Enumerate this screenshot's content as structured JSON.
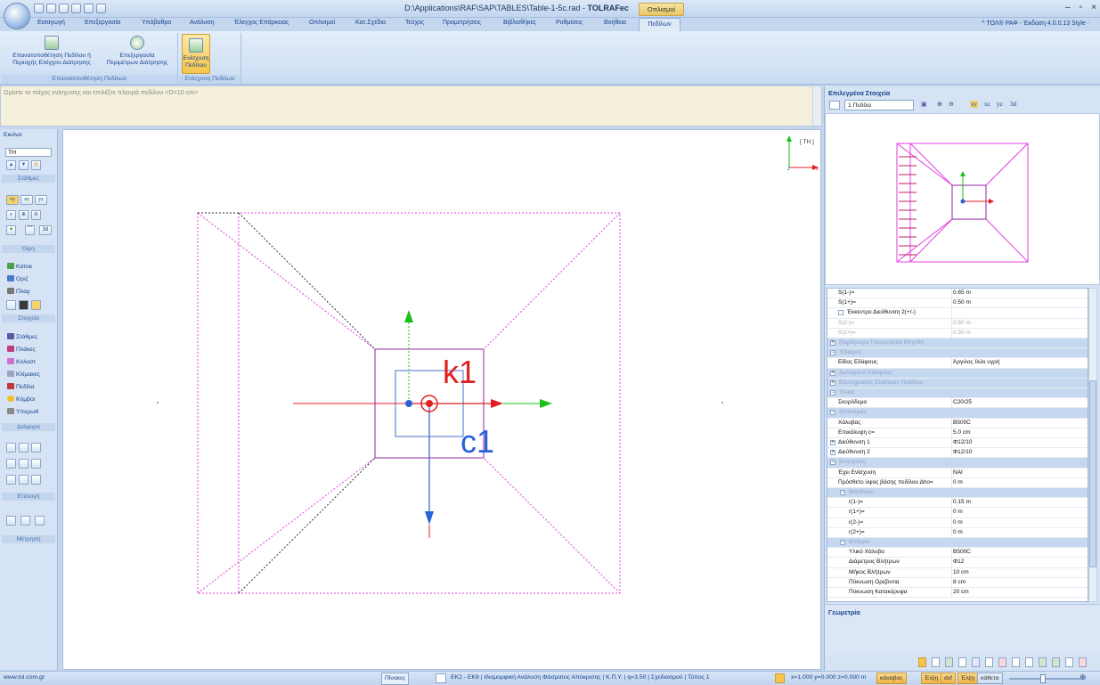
{
  "window": {
    "path": "D:\\Applications\\RAF\\SAP\\TABLES\\Table-1-5c.rad - ",
    "app": "TOLRAFec",
    "context_tab": "Οπλισμοί",
    "controls": [
      "–",
      "▫",
      "×"
    ]
  },
  "menu": {
    "tabs": [
      "Εισαγωγή",
      "Επεξεργασία",
      "Υπόβαθρο",
      "Ανάλυση",
      "Έλεγχος Επάρκειας",
      "Οπλισμοί",
      "Κατ.Σχέδια",
      "Τεύχος",
      "Προμετρήσεις",
      "Βιβλιοθήκες",
      "Ρυθμίσεις",
      "Βοήθεια"
    ],
    "active_tab": "Πεδίλων",
    "version": "^ ΤΟΛ® ΡΑΦ - Έκδοση 4.0.0.13   Style ·"
  },
  "ribbon": {
    "group1": {
      "btn1": [
        "Επανατοποθέτηση Πεδίλου ή",
        "Περιοχής Ελέγχου Διάτρησης"
      ],
      "btn2": [
        "Επεξεργασία",
        "Περιμέτρων Διάτρησης"
      ],
      "label": "Επανατοποθέτηση Πεδίλων"
    },
    "group2": {
      "btn1": [
        "Ενίσχυση",
        "Πεδίλου"
      ],
      "label": "Ενίσχυση Πεδίλων"
    }
  },
  "prompt": "Ορίστε το πάχος ενίσχυσης και επιλέξτε πλευρά πεδίλου  <D=10 cm>",
  "left_panel": {
    "title": "Εικόνα",
    "view_select": "TH",
    "sections": {
      "stathmes": "Στάθμες",
      "opsi": "Όψη",
      "stoixeia": "Στοιχεία",
      "diafora": "Διάφορα",
      "epilogi": "Επιλογή",
      "metrisi": "Μέτρηση"
    },
    "view_btns": [
      "xy",
      "xz",
      "yz"
    ],
    "btn_3d": "3d",
    "view_items": [
      "Κατοκ",
      "Οριζ",
      "Πλαγ"
    ],
    "element_items": [
      "Στάθμες",
      "Πλάκες",
      "Κολοστ",
      "Κλίμακες",
      "Πεδίλα",
      "Κόμβοι",
      "Υπερωθ"
    ]
  },
  "canvas": {
    "label_k1": "k1",
    "label_c1": "c1",
    "view_tag": "[ TH ]",
    "axis_x": "x",
    "axis_z": "z"
  },
  "right_panel": {
    "title": "Επιλεγμένα Στοιχεία",
    "select_value": "1 Πεδίλα",
    "tb_xy": "xy",
    "tb_xz": "xz",
    "tb_yz": "yz",
    "tb_3d": "3d",
    "properties": [
      {
        "k": "S(1-)=",
        "v": "0.65 m"
      },
      {
        "k": "S(1+)=",
        "v": "0.50 m"
      },
      {
        "k": "Έκκεντρο Διεύθυνση 2(+/-)",
        "v": ""
      },
      {
        "k": "S(2-)=",
        "v": "0.50 m"
      },
      {
        "k": "S(2+)=",
        "v": "0.50 m"
      },
      {
        "k": "Παράγωγα Γεωμετρικά Μεγέθη",
        "v": ""
      },
      {
        "k": "Έδαφος",
        "v": ""
      },
      {
        "k": "Είδος Εδάφους",
        "v": "Άργιλος Ιλύο υγρή"
      },
      {
        "k": "Δεδομένα Εδάφους",
        "v": ""
      },
      {
        "k": "Ελατηριακές Σταθερές Πεδίλου",
        "v": ""
      },
      {
        "k": "Υλικά",
        "v": ""
      },
      {
        "k": "Σκυρόδεμα",
        "v": "C20/25"
      },
      {
        "k": "Οπλισμός",
        "v": ""
      },
      {
        "k": "Χάλυβας",
        "v": "B500C"
      },
      {
        "k": "Επικάλυψη c=",
        "v": "5.0 cm"
      },
      {
        "k": "Διεύθυνση 1",
        "v": "Φ12/10"
      },
      {
        "k": "Διεύθυνση 2",
        "v": "Φ12/10"
      },
      {
        "k": "Ενίσχυση",
        "v": ""
      },
      {
        "k": "Έχει Ενίσχυση",
        "v": "ΝΑΙ"
      },
      {
        "k": "Πρόσθετο ύψος βάσης πεδίλου Δho=",
        "v": "0 m"
      },
      {
        "k": "Μανδύας",
        "v": ""
      },
      {
        "k": "r(1-)=",
        "v": "0.15 m"
      },
      {
        "k": "r(1+)=",
        "v": "0 m"
      },
      {
        "k": "r(2-)=",
        "v": "0 m"
      },
      {
        "k": "r(2+)=",
        "v": "0 m"
      },
      {
        "k": "Βλήτρα",
        "v": ""
      },
      {
        "k": "Υλικό Χάλυβα",
        "v": "B500C"
      },
      {
        "k": "Διάμετρος Βλήτρων",
        "v": "Φ12"
      },
      {
        "k": "Μήκος Βλήτρων",
        "v": "10 cm"
      },
      {
        "k": "Πύκνωση Οριζόντια",
        "v": "8 cm"
      },
      {
        "k": "Πύκνωση Κατακόρυφα",
        "v": "20 cm"
      }
    ],
    "geometry_title": "Γεωμετρία"
  },
  "status": {
    "url": "www.tol.com.gr",
    "tables": "Πίνακες",
    "info": "ΕΚ2 - ΕΚ8 | Ιδιομορφική Ανάλυση Φάσματος Απόκρισης | Κ.Π.Υ. | q=3.50 | Σχεδιασμού | Τύπος 1",
    "coords": "x=1.000 y=0.000 z=0.000 m",
    "btns": [
      "κάναβος",
      "Έλξη",
      "dxf",
      "Έλξη",
      "κάθετα"
    ]
  },
  "colors": {
    "footing": "#e040e0",
    "column": "#4a72c8",
    "red": "#e02020",
    "green": "#18c018",
    "blue": "#2a62d8",
    "highlight": "#f6c54a"
  }
}
